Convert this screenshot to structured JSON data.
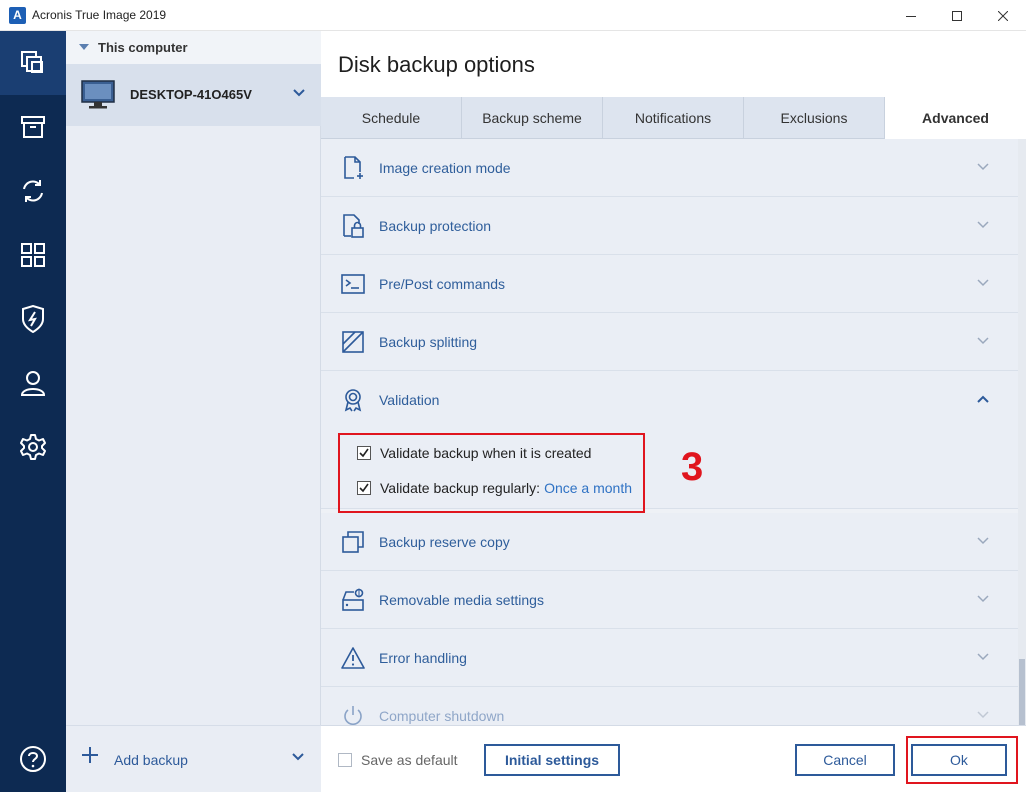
{
  "window": {
    "title": "Acronis True Image 2019",
    "logo_letter": "A"
  },
  "sidebar": {
    "items": [
      {
        "icon": "backup-icon",
        "active": true
      },
      {
        "icon": "archive-icon",
        "active": false
      },
      {
        "icon": "sync-icon",
        "active": false
      },
      {
        "icon": "tools-icon",
        "active": false
      },
      {
        "icon": "active-protection-icon",
        "active": false
      },
      {
        "icon": "account-icon",
        "active": false
      },
      {
        "icon": "settings-icon",
        "active": false
      }
    ],
    "help_icon": "help-icon"
  },
  "sources": {
    "header": "This computer",
    "computer_name": "DESKTOP-41O465V",
    "add_backup": "Add backup"
  },
  "main": {
    "title": "Disk backup options",
    "tabs": [
      {
        "label": "Schedule",
        "active": false
      },
      {
        "label": "Backup scheme",
        "active": false
      },
      {
        "label": "Notifications",
        "active": false
      },
      {
        "label": "Exclusions",
        "active": false
      },
      {
        "label": "Advanced",
        "active": true
      }
    ],
    "options": [
      {
        "label": "Image creation mode",
        "icon": "image-creation-icon",
        "expanded": false
      },
      {
        "label": "Backup protection",
        "icon": "lock-file-icon",
        "expanded": false
      },
      {
        "label": "Pre/Post commands",
        "icon": "terminal-icon",
        "expanded": false
      },
      {
        "label": "Backup splitting",
        "icon": "split-icon",
        "expanded": false
      },
      {
        "label": "Validation",
        "icon": "badge-icon",
        "expanded": true
      },
      {
        "label": "Backup reserve copy",
        "icon": "copy-icon",
        "expanded": false
      },
      {
        "label": "Removable media settings",
        "icon": "removable-media-icon",
        "expanded": false
      },
      {
        "label": "Error handling",
        "icon": "warning-icon",
        "expanded": false
      },
      {
        "label": "Computer shutdown",
        "icon": "power-icon",
        "expanded": false
      }
    ],
    "validation": {
      "validate_on_create": {
        "label": "Validate backup when it is created",
        "checked": true
      },
      "validate_regularly": {
        "label": "Validate backup regularly:",
        "link": "Once a month",
        "checked": true
      }
    },
    "annotation_step": "3"
  },
  "footer": {
    "save_as_default": {
      "label": "Save as default",
      "checked": false
    },
    "initial_settings": "Initial settings",
    "cancel": "Cancel",
    "ok": "Ok"
  },
  "colors": {
    "rail_bg": "#0d2a52",
    "accent": "#2d5a9a",
    "link": "#2f72c4",
    "highlight": "#e0151e"
  }
}
